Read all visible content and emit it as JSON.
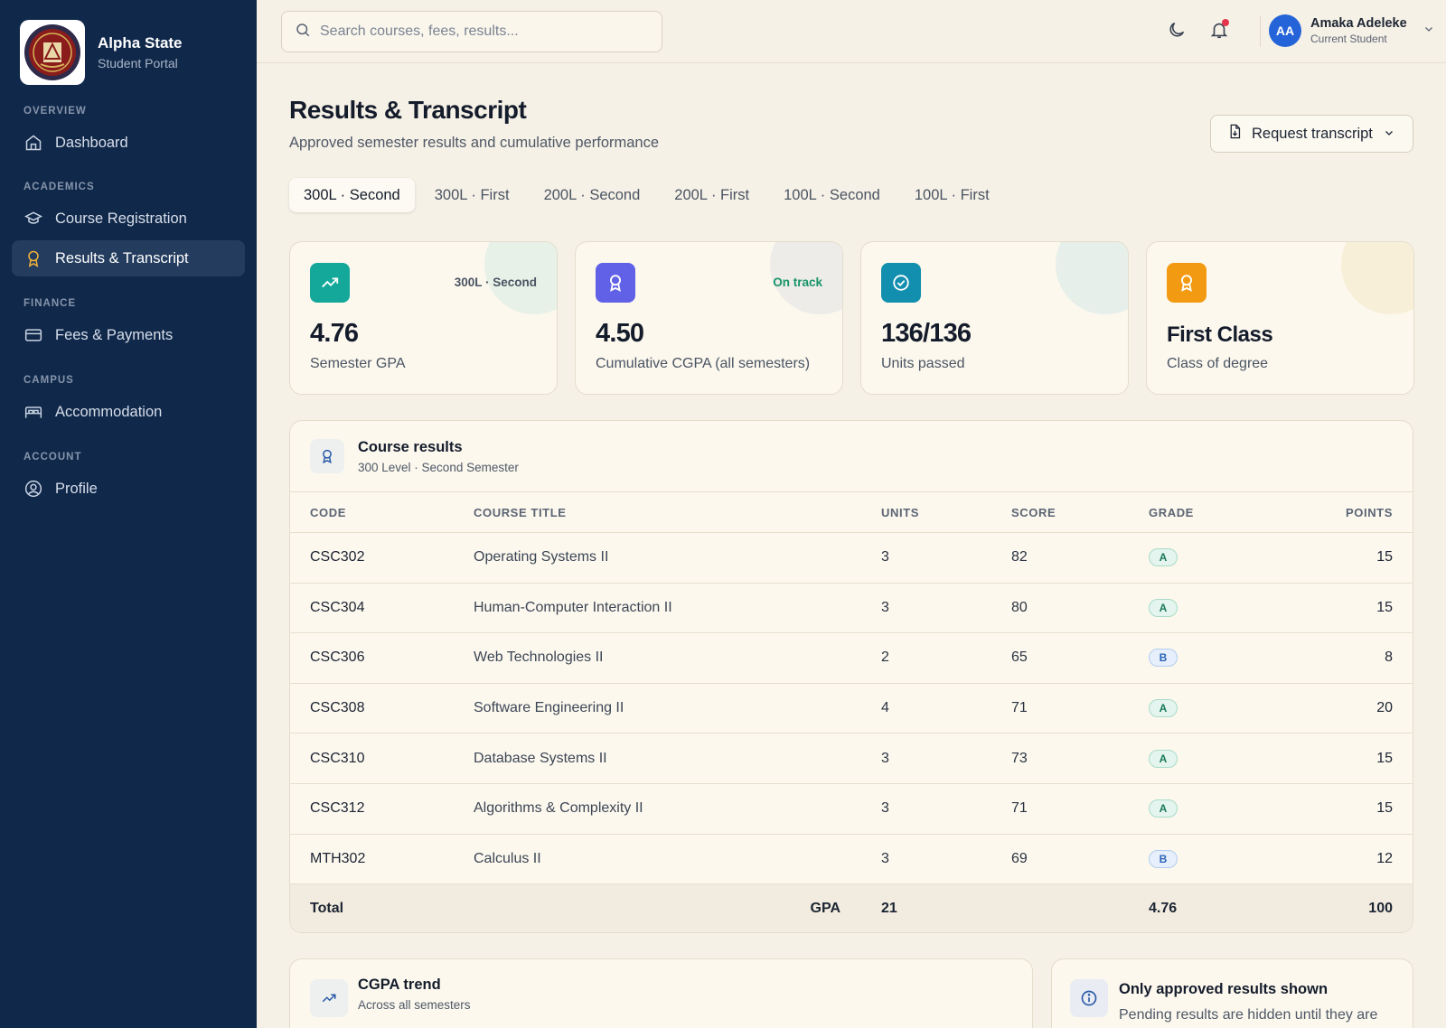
{
  "brand": {
    "name": "Alpha State",
    "subtitle": "Student Portal"
  },
  "sidebar": {
    "sections": [
      {
        "label": "OVERVIEW"
      },
      {
        "label": "ACADEMICS"
      },
      {
        "label": "FINANCE"
      },
      {
        "label": "CAMPUS"
      },
      {
        "label": "ACCOUNT"
      }
    ],
    "items": [
      {
        "label": "Dashboard",
        "icon": "home-icon"
      },
      {
        "label": "Course Registration",
        "icon": "graduation-cap-icon"
      },
      {
        "label": "Results & Transcript",
        "icon": "award-icon",
        "active": true
      },
      {
        "label": "Fees & Payments",
        "icon": "credit-card-icon"
      },
      {
        "label": "Accommodation",
        "icon": "bed-icon"
      },
      {
        "label": "Profile",
        "icon": "user-circle-icon"
      }
    ]
  },
  "search": {
    "placeholder": "Search courses, fees, results..."
  },
  "user": {
    "initials": "AA",
    "name": "Amaka Adeleke",
    "role": "Current Student"
  },
  "page": {
    "title": "Results & Transcript",
    "subtitle": "Approved semester results and cumulative performance",
    "request_button": "Request transcript"
  },
  "tabs": [
    {
      "label": "300L · Second",
      "active": true
    },
    {
      "label": "300L · First"
    },
    {
      "label": "200L · Second"
    },
    {
      "label": "200L · First"
    },
    {
      "label": "100L · Second"
    },
    {
      "label": "100L · First"
    }
  ],
  "stats": [
    {
      "value": "4.76",
      "label": "Semester GPA",
      "tag": "300L · Second",
      "color": "#14a89a",
      "icon": "trending-up-icon"
    },
    {
      "value": "4.50",
      "label": "Cumulative CGPA (all semesters)",
      "tag": "On track",
      "color": "#6161e8",
      "icon": "award-icon"
    },
    {
      "value": "136/136",
      "label": "Units passed",
      "tag": "",
      "color": "#128fae",
      "icon": "check-circle-icon"
    },
    {
      "value": "First Class",
      "label": "Class of degree",
      "tag": "",
      "color": "#f29a12",
      "icon": "award-icon"
    }
  ],
  "results": {
    "title": "Course results",
    "subtitle": "300 Level · Second Semester",
    "columns": {
      "code": "CODE",
      "title": "COURSE TITLE",
      "units": "UNITS",
      "score": "SCORE",
      "grade": "GRADE",
      "points": "POINTS"
    },
    "rows": [
      {
        "code": "CSC302",
        "title": "Operating Systems II",
        "units": "3",
        "score": "82",
        "grade": "A",
        "points": "15"
      },
      {
        "code": "CSC304",
        "title": "Human-Computer Interaction II",
        "units": "3",
        "score": "80",
        "grade": "A",
        "points": "15"
      },
      {
        "code": "CSC306",
        "title": "Web Technologies II",
        "units": "2",
        "score": "65",
        "grade": "B",
        "points": "8"
      },
      {
        "code": "CSC308",
        "title": "Software Engineering II",
        "units": "4",
        "score": "71",
        "grade": "A",
        "points": "20"
      },
      {
        "code": "CSC310",
        "title": "Database Systems II",
        "units": "3",
        "score": "73",
        "grade": "A",
        "points": "15"
      },
      {
        "code": "CSC312",
        "title": "Algorithms & Complexity II",
        "units": "3",
        "score": "71",
        "grade": "A",
        "points": "15"
      },
      {
        "code": "MTH302",
        "title": "Calculus II",
        "units": "3",
        "score": "69",
        "grade": "B",
        "points": "12"
      }
    ],
    "total": {
      "label": "Total",
      "gpa_label": "GPA",
      "units": "21",
      "gpa": "4.76",
      "points": "100"
    }
  },
  "trend": {
    "title": "CGPA trend",
    "subtitle": "Across all semesters"
  },
  "notice": {
    "title": "Only approved results shown",
    "text": "Pending results are hidden until they are"
  }
}
